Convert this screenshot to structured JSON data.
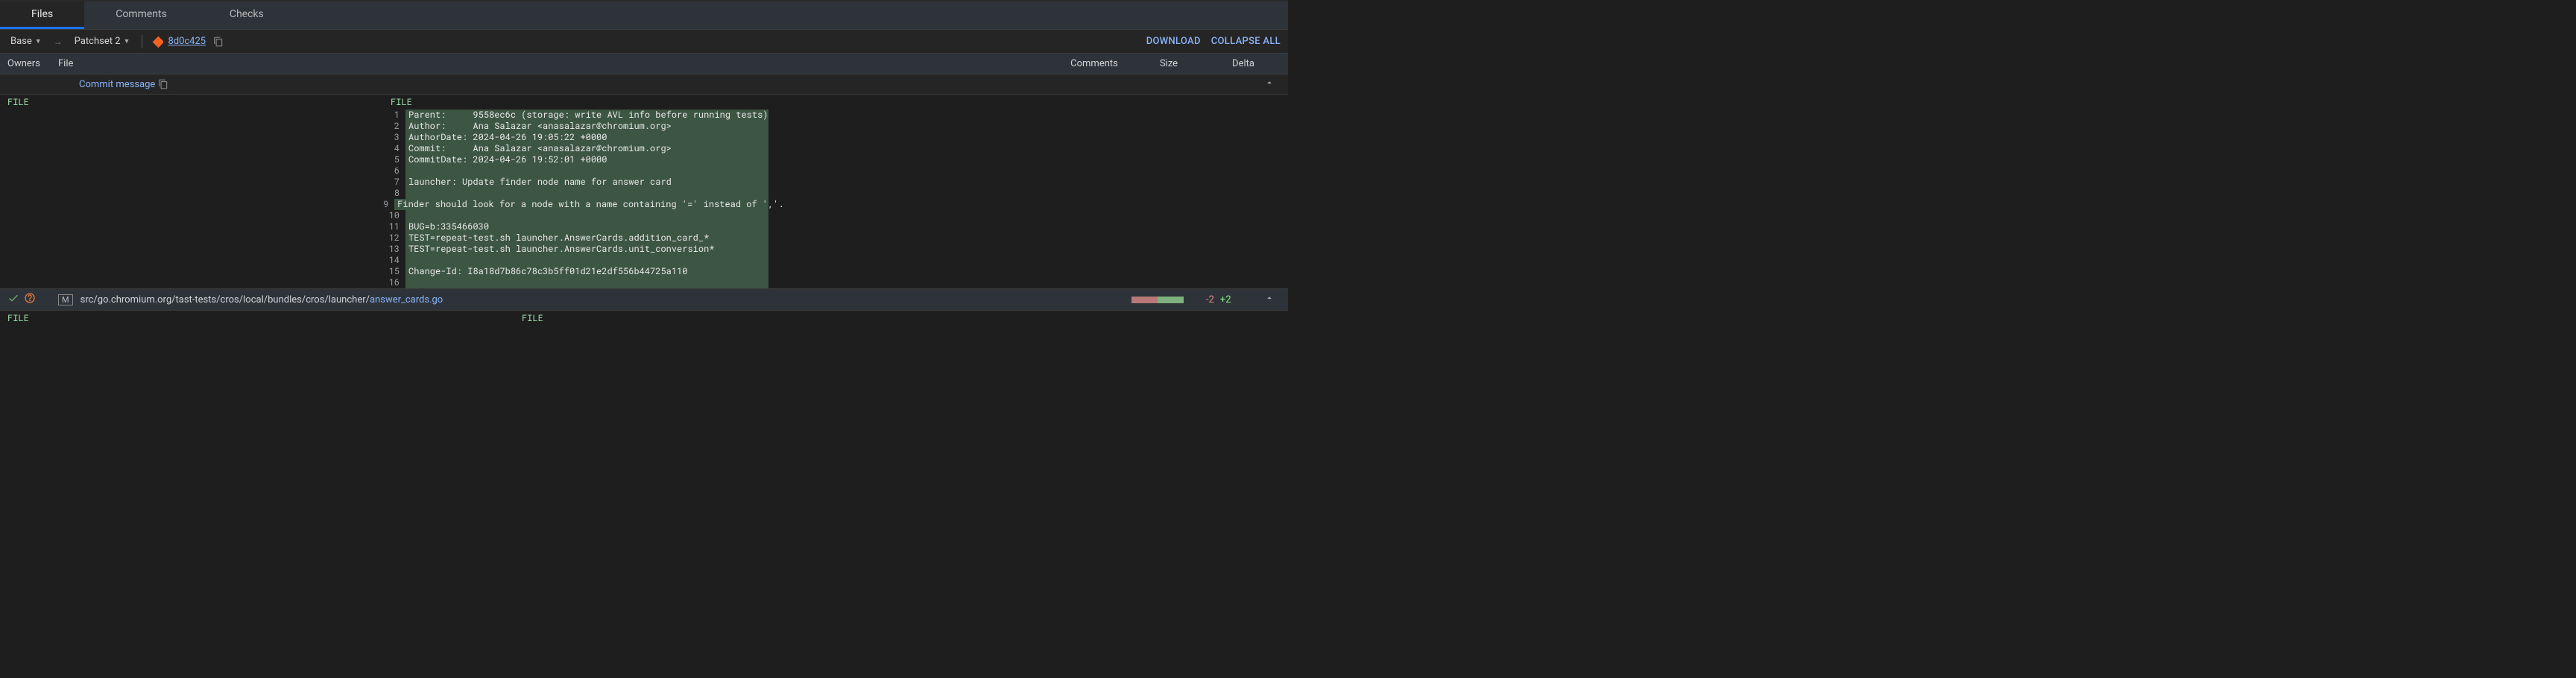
{
  "tabs": {
    "files": "Files",
    "comments": "Comments",
    "checks": "Checks"
  },
  "toolbar": {
    "base": "Base",
    "patchset": "Patchset 2",
    "commit_hash": "8d0c425",
    "download": "DOWNLOAD",
    "collapse_all": "COLLAPSE ALL"
  },
  "headers": {
    "owners": "Owners",
    "file": "File",
    "comments": "Comments",
    "size": "Size",
    "delta": "Delta"
  },
  "commit_message": {
    "label": "Commit message"
  },
  "file_label_left": "FILE",
  "file_label_right": "FILE",
  "diff_lines": [
    {
      "num": "1",
      "text": "Parent:     9558ec6c (storage: write AVL info before running tests)"
    },
    {
      "num": "2",
      "text": "Author:     Ana Salazar <anasalazar@chromium.org>"
    },
    {
      "num": "3",
      "text": "AuthorDate: 2024-04-26 19:05:22 +0000"
    },
    {
      "num": "4",
      "text": "Commit:     Ana Salazar <anasalazar@chromium.org>"
    },
    {
      "num": "5",
      "text": "CommitDate: 2024-04-26 19:52:01 +0000"
    },
    {
      "num": "6",
      "text": ""
    },
    {
      "num": "7",
      "text": "launcher: Update finder node name for answer card"
    },
    {
      "num": "8",
      "text": ""
    },
    {
      "num": "9",
      "text": "Finder should look for a node with a name containing '=' instead of ','."
    },
    {
      "num": "10",
      "text": ""
    },
    {
      "num": "11",
      "text": "BUG=b:335466030"
    },
    {
      "num": "12",
      "text": "TEST=repeat-test.sh launcher.AnswerCards.addition_card_*"
    },
    {
      "num": "13",
      "text": "TEST=repeat-test.sh launcher.AnswerCards.unit_conversion*"
    },
    {
      "num": "14",
      "text": ""
    },
    {
      "num": "15",
      "text": "Change-Id: I8a18d7b86c78c3b5ff01d21e2df556b44725a110"
    },
    {
      "num": "16",
      "text": ""
    }
  ],
  "file_row": {
    "mod_badge": "M",
    "path_prefix": "src/go.chromium.org/tast-tests/cros/local/bundles/cros/launcher/",
    "path_name": "answer_cards.go",
    "delta_del": "-2",
    "delta_add": "+2"
  },
  "bottom_file_left": "FILE",
  "bottom_file_right": "FILE"
}
